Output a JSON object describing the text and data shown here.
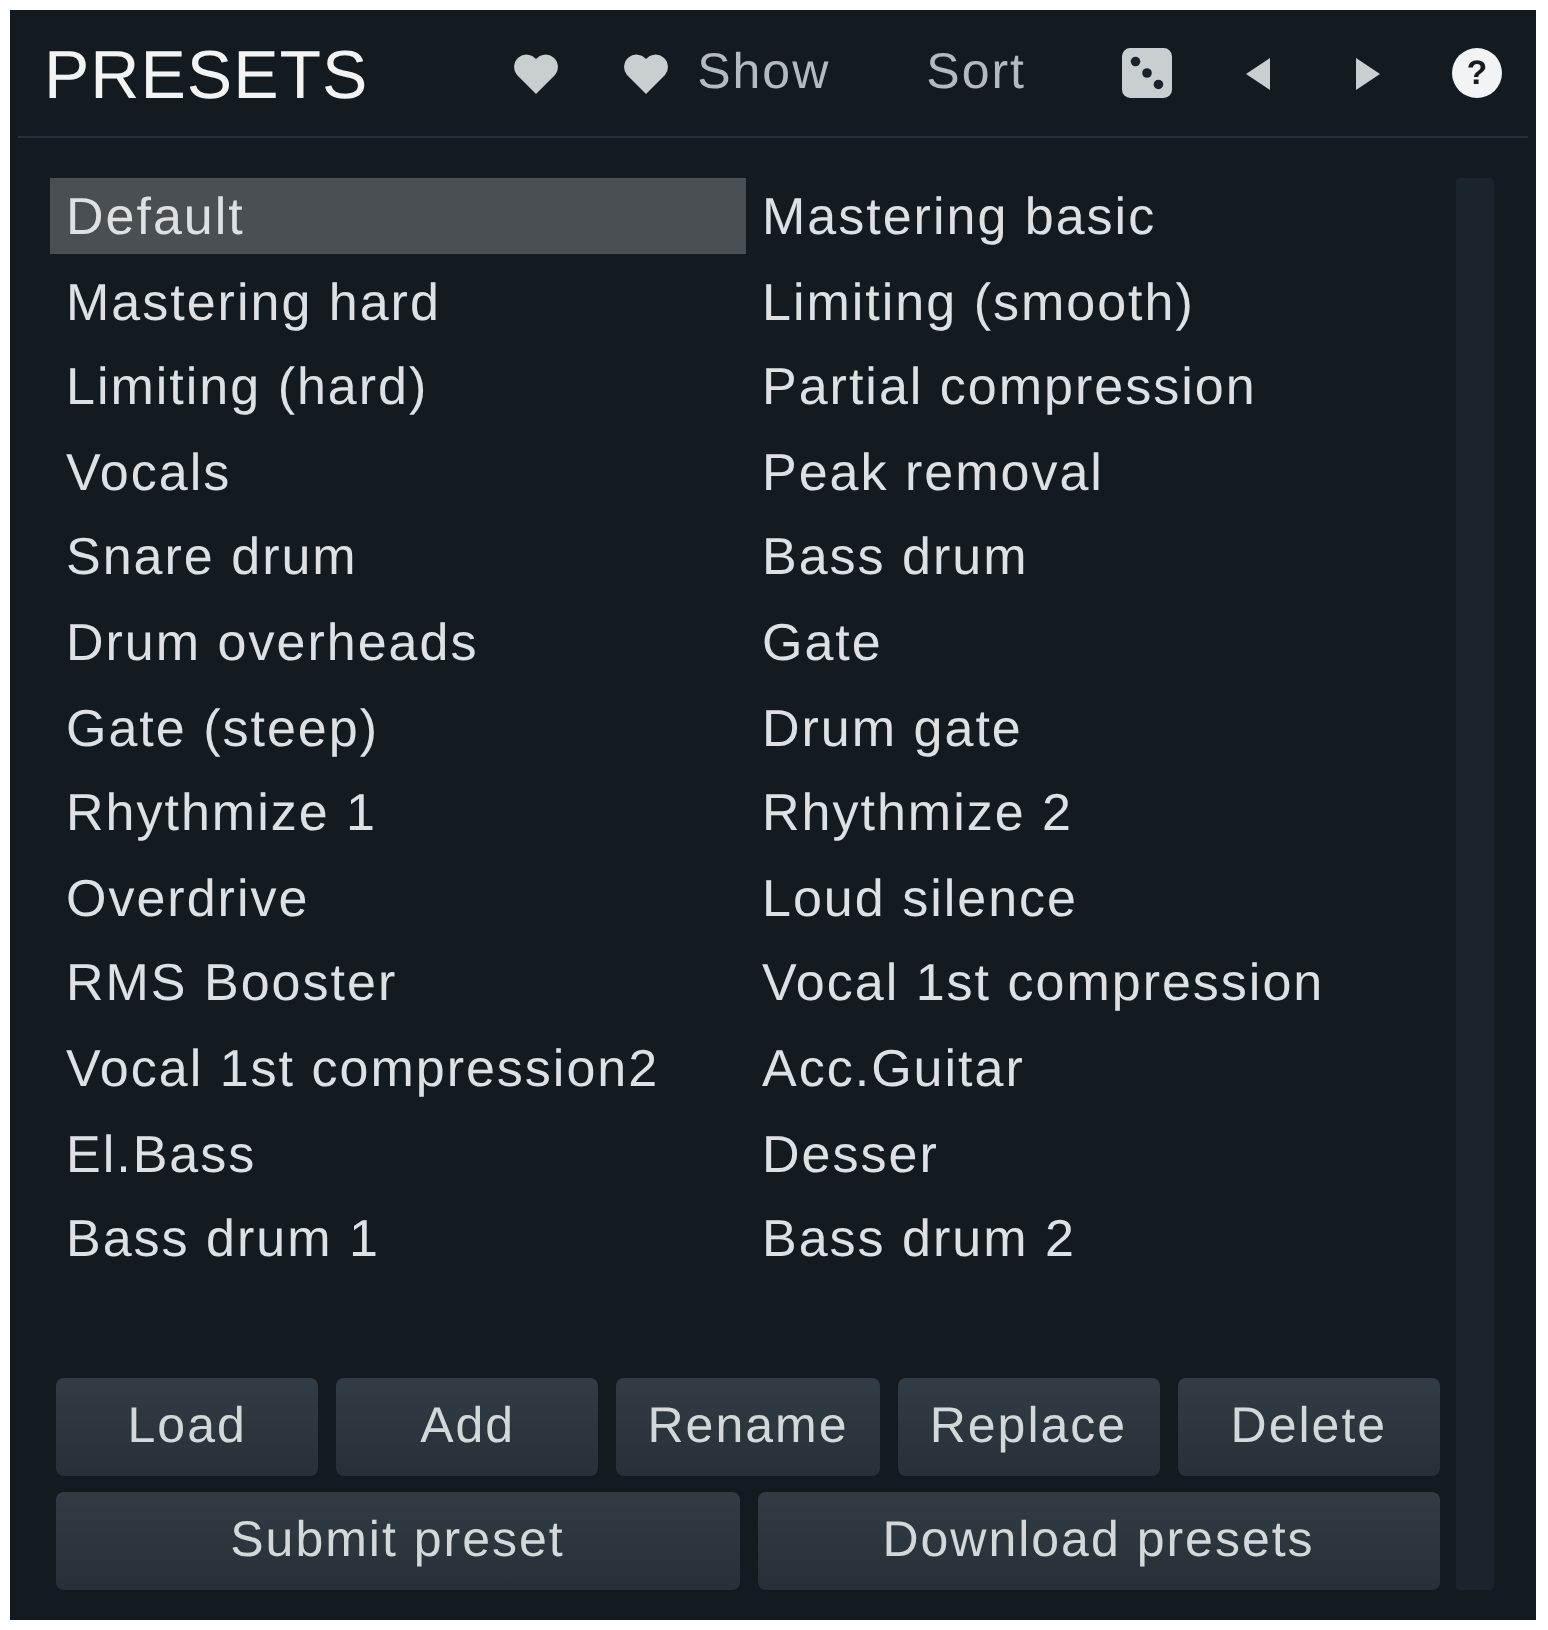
{
  "header": {
    "title": "PRESETS",
    "show_label": "Show",
    "sort_label": "Sort",
    "help_label": "?"
  },
  "presets": [
    {
      "label": "Default",
      "selected": true
    },
    {
      "label": "Mastering basic",
      "selected": false
    },
    {
      "label": "Mastering hard",
      "selected": false
    },
    {
      "label": "Limiting (smooth)",
      "selected": false
    },
    {
      "label": "Limiting (hard)",
      "selected": false
    },
    {
      "label": "Partial compression",
      "selected": false
    },
    {
      "label": "Vocals",
      "selected": false
    },
    {
      "label": "Peak removal",
      "selected": false
    },
    {
      "label": "Snare drum",
      "selected": false
    },
    {
      "label": "Bass drum",
      "selected": false
    },
    {
      "label": "Drum overheads",
      "selected": false
    },
    {
      "label": "Gate",
      "selected": false
    },
    {
      "label": "Gate (steep)",
      "selected": false
    },
    {
      "label": "Drum gate",
      "selected": false
    },
    {
      "label": "Rhythmize 1",
      "selected": false
    },
    {
      "label": "Rhythmize 2",
      "selected": false
    },
    {
      "label": "Overdrive",
      "selected": false
    },
    {
      "label": "Loud silence",
      "selected": false
    },
    {
      "label": "RMS Booster",
      "selected": false
    },
    {
      "label": "Vocal 1st compression",
      "selected": false
    },
    {
      "label": "Vocal 1st compression2",
      "selected": false
    },
    {
      "label": "Acc.Guitar",
      "selected": false
    },
    {
      "label": "El.Bass",
      "selected": false
    },
    {
      "label": "Desser",
      "selected": false
    },
    {
      "label": "Bass drum 1",
      "selected": false
    },
    {
      "label": "Bass drum 2",
      "selected": false
    }
  ],
  "action_buttons": [
    "Load",
    "Add",
    "Rename",
    "Replace",
    "Delete"
  ],
  "share_buttons": [
    "Submit preset",
    "Download presets"
  ]
}
